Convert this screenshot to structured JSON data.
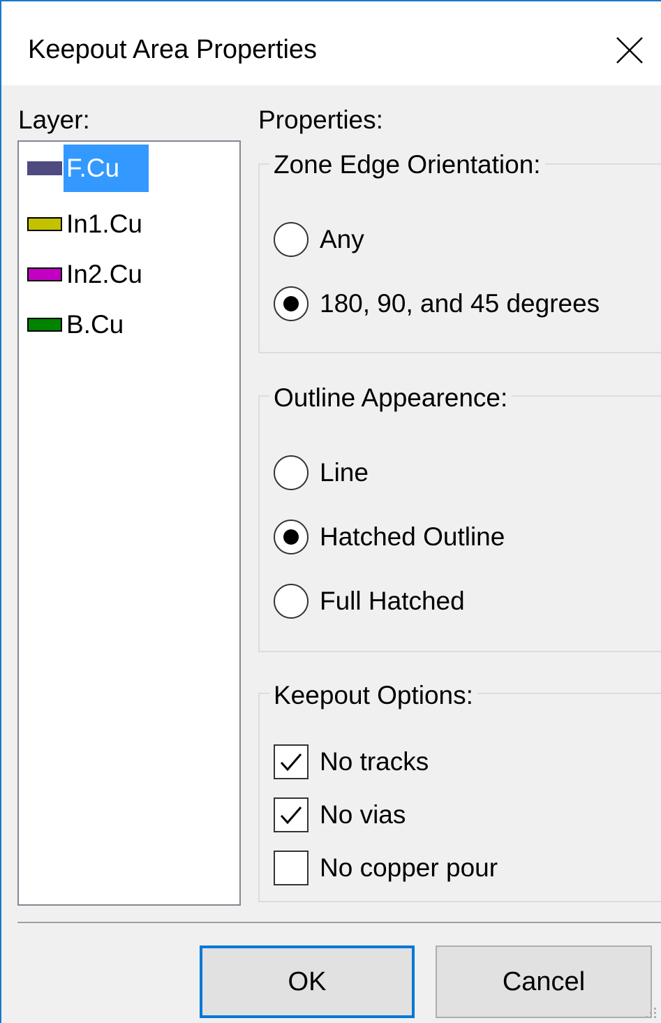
{
  "window": {
    "title": "Keepout Area Properties",
    "close_icon": "close-icon"
  },
  "layers": {
    "label": "Layer:",
    "items": [
      {
        "name": "F.Cu",
        "color": "#4f4a80",
        "selected": true
      },
      {
        "name": "In1.Cu",
        "color": "#c2c200",
        "selected": false
      },
      {
        "name": "In2.Cu",
        "color": "#c200c2",
        "selected": false
      },
      {
        "name": "B.Cu",
        "color": "#008400",
        "selected": false
      }
    ]
  },
  "properties": {
    "label": "Properties:",
    "zone_edge": {
      "title": "Zone Edge Orientation:",
      "options": [
        {
          "label": "Any",
          "checked": false
        },
        {
          "label": "180, 90, and 45 degrees",
          "checked": true
        }
      ]
    },
    "outline": {
      "title": "Outline Appearence:",
      "options": [
        {
          "label": "Line",
          "checked": false
        },
        {
          "label": "Hatched Outline",
          "checked": true
        },
        {
          "label": "Full Hatched",
          "checked": false
        }
      ]
    },
    "keepout": {
      "title": "Keepout Options:",
      "options": [
        {
          "label": "No tracks",
          "checked": true
        },
        {
          "label": "No vias",
          "checked": true
        },
        {
          "label": "No copper pour",
          "checked": false
        }
      ]
    }
  },
  "buttons": {
    "ok": "OK",
    "cancel": "Cancel"
  },
  "colors": {
    "accent": "#0078d7",
    "selection": "#3399ff",
    "title_border": "#1979ca"
  }
}
